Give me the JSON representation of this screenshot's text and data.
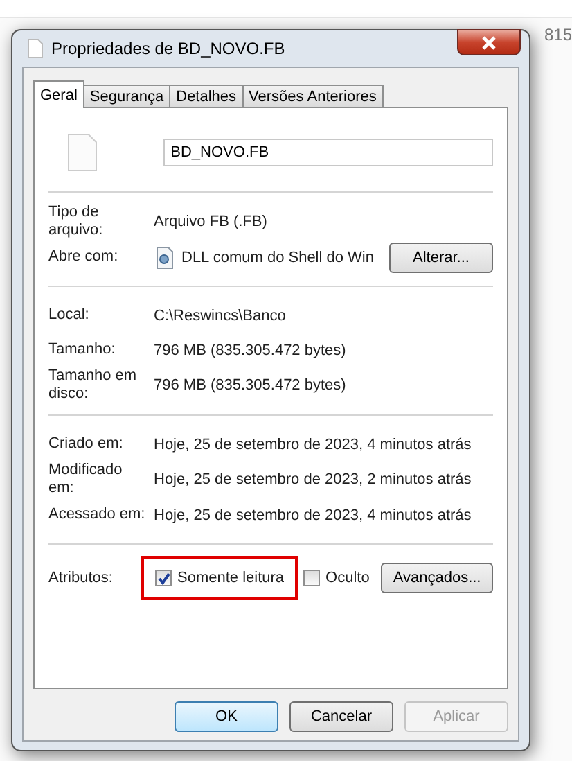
{
  "background": {
    "size_text": "815"
  },
  "window": {
    "title": "Propriedades de BD_NOVO.FB"
  },
  "tabs": [
    {
      "label": "Geral",
      "selected": true
    },
    {
      "label": "Segurança",
      "selected": false
    },
    {
      "label": "Detalhes",
      "selected": false
    },
    {
      "label": "Versões Anteriores",
      "selected": false
    }
  ],
  "file_name": "BD_NOVO.FB",
  "sections": [
    {
      "rows": [
        {
          "kind": "text",
          "label": "Tipo de arquivo:",
          "value": "Arquivo FB (.FB)"
        },
        {
          "kind": "app",
          "label": "Abre com:",
          "value": "DLL comum do Shell do Win",
          "button": "Alterar..."
        }
      ]
    },
    {
      "rows": [
        {
          "kind": "text",
          "label": "Local:",
          "value": "C:\\Reswincs\\Banco"
        },
        {
          "kind": "text",
          "label": "Tamanho:",
          "value": "796 MB (835.305.472 bytes)"
        },
        {
          "kind": "text",
          "label": "Tamanho em disco:",
          "value": "796 MB (835.305.472 bytes)"
        }
      ]
    },
    {
      "rows": [
        {
          "kind": "text",
          "label": "Criado em:",
          "value": "Hoje, 25 de setembro de 2023, 4 minutos atrás"
        },
        {
          "kind": "text",
          "label": "Modificado em:",
          "value": "Hoje, 25 de setembro de 2023, 2 minutos atrás"
        },
        {
          "kind": "text",
          "label": "Acessado em:",
          "value": "Hoje, 25 de setembro de 2023, 4 minutos atrás"
        }
      ]
    }
  ],
  "attributes": {
    "label": "Atributos:",
    "options": [
      {
        "label": "Somente leitura",
        "checked": true,
        "highlighted": true
      },
      {
        "label": "Oculto",
        "checked": false,
        "highlighted": false
      }
    ],
    "button": "Avançados..."
  },
  "buttons": [
    {
      "label": "OK",
      "default": true,
      "disabled": false
    },
    {
      "label": "Cancelar",
      "default": false,
      "disabled": false
    },
    {
      "label": "Aplicar",
      "default": false,
      "disabled": true
    }
  ]
}
